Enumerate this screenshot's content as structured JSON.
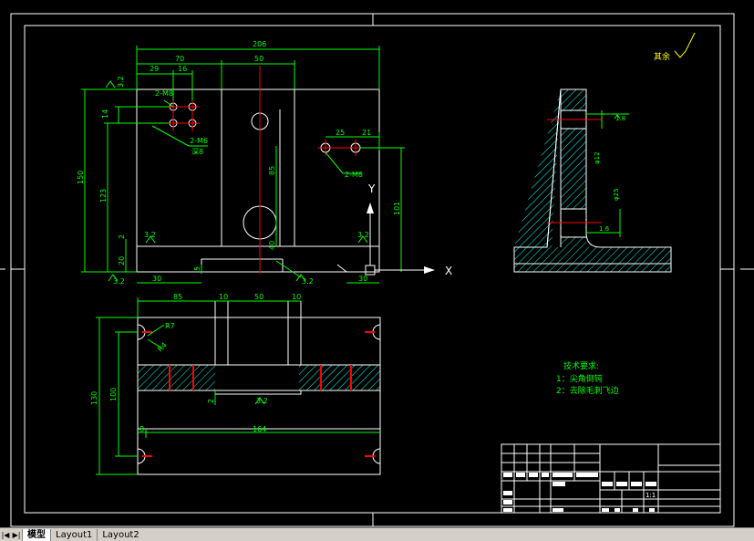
{
  "drawing": {
    "views": {
      "top": {
        "dims": {
          "overall_width": "206",
          "d70": "70",
          "d50": "50",
          "d29": "29",
          "d16": "16",
          "note_2m8_a": "2-M8",
          "r32a": "3.2",
          "d14": "14",
          "note_2m6": "2-M6",
          "note_deep": "深8",
          "d150": "150",
          "d123": "123",
          "d85": "85",
          "d101": "101",
          "d25": "25",
          "d21": "21",
          "note_2m8_b": "2-M8",
          "d2": "2",
          "r32b": "3.2",
          "d20": "20",
          "r32c": "3.2",
          "d30a": "30",
          "d5": "5",
          "r32d": "3.2",
          "d30b": "30",
          "d40": "40",
          "r32e": "3.2",
          "r32f": "3.2"
        },
        "axis_y": "Y",
        "axis_x": "X"
      },
      "front": {
        "dims": {
          "d85": "85",
          "d10a": "10",
          "d50": "50",
          "d10b": "10",
          "r7": "R7",
          "r4": "R4",
          "d130": "130",
          "d100": "100",
          "d2": "2",
          "r32": "3.2",
          "d8": "8",
          "d164": "164"
        }
      },
      "side": {
        "dims": {
          "r18": "1.8",
          "d12": "φ12",
          "d25": "φ25",
          "r16": "1.6"
        }
      }
    },
    "surface_note": "其余",
    "tech_req": {
      "title": "技术要求:",
      "items": [
        "1：尖角倒钝",
        "2：去除毛刺飞边"
      ]
    },
    "title_block": {
      "scale": "1:1"
    }
  },
  "tabs": {
    "model": "模型",
    "layout1": "Layout1",
    "layout2": "Layout2"
  },
  "colors": {
    "background": "#000000",
    "geometry": "#ffffff",
    "dimension": "#00ff00",
    "center": "#ff0000",
    "hatch": "#00ffff",
    "text": "#ffff00"
  }
}
